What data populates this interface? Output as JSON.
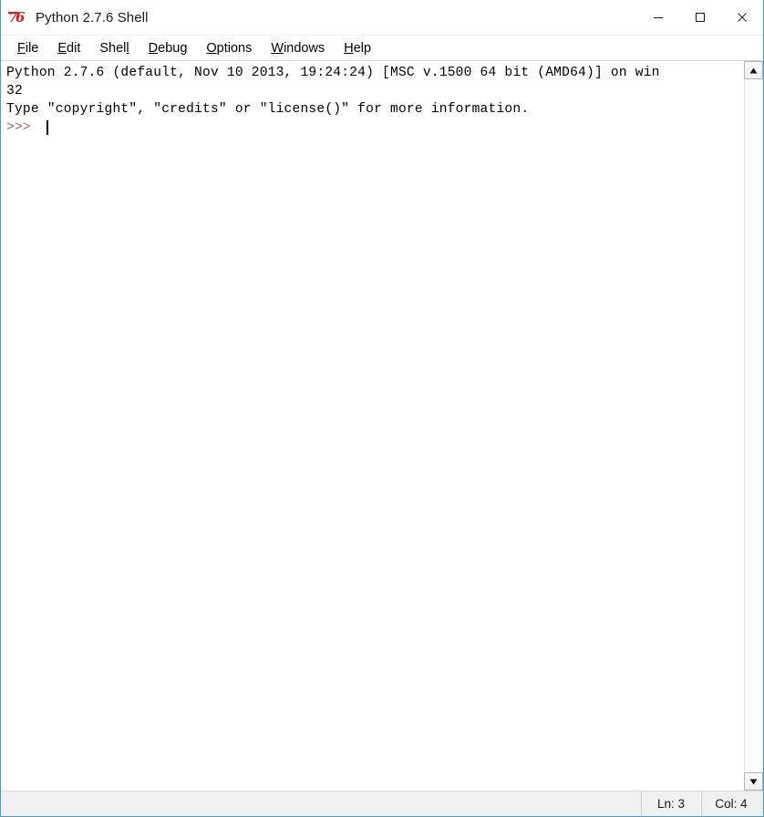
{
  "window": {
    "title": "Python 2.7.6 Shell",
    "icon": "python-idle-icon",
    "border_color": "#3f9fd4"
  },
  "titlebar": {
    "minimize_label": "Minimize",
    "maximize_label": "Maximize",
    "close_label": "Close"
  },
  "menubar": {
    "items": [
      {
        "label": "File",
        "accel_index": 0
      },
      {
        "label": "Edit",
        "accel_index": 0
      },
      {
        "label": "Shell",
        "accel_index": 4
      },
      {
        "label": "Debug",
        "accel_index": 0
      },
      {
        "label": "Options",
        "accel_index": 0
      },
      {
        "label": "Windows",
        "accel_index": 0
      },
      {
        "label": "Help",
        "accel_index": 0
      }
    ]
  },
  "shell": {
    "lines": [
      "Python 2.7.6 (default, Nov 10 2013, 19:24:24) [MSC v.1500 64 bit (AMD64)] on win",
      "32",
      "Type \"copyright\", \"credits\" or \"license()\" for more information."
    ],
    "prompt": ">>> ",
    "prompt_color": "#b05b5b",
    "input_value": "",
    "text_color": "#000000",
    "background": "#ffffff"
  },
  "scrollbar": {
    "up_arrow": "scroll-up-arrow-icon",
    "down_arrow": "scroll-down-arrow-icon"
  },
  "statusbar": {
    "line_label": "Ln: 3",
    "col_label": "Col: 4"
  }
}
